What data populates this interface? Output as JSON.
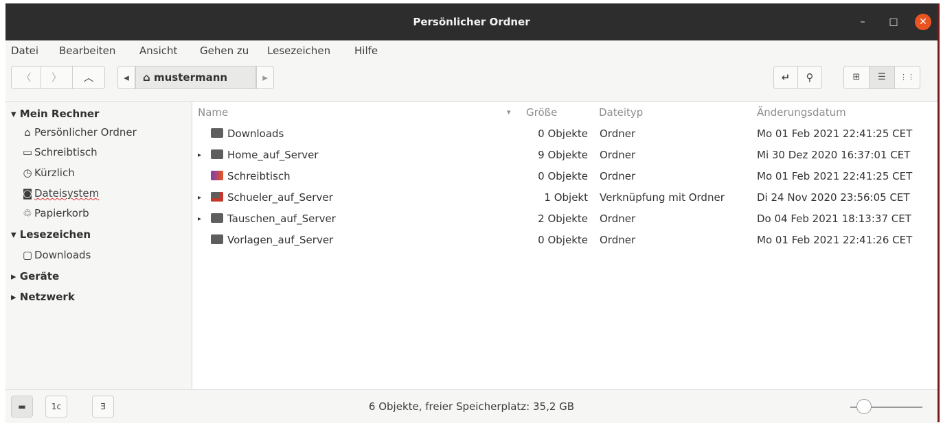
{
  "window": {
    "title": "Persönlicher Ordner",
    "minimize": "–",
    "maximize": "□",
    "close": "✕"
  },
  "menu": [
    "Datei",
    "Bearbeiten",
    "Ansicht",
    "Gehen zu",
    "Lesezeichen",
    "Hilfe"
  ],
  "toolbar": {
    "back": "〈",
    "forward": "〉",
    "up": "︿",
    "path_left": "◂",
    "path_home_icon": "⌂",
    "path_current": "mustermann",
    "path_right": "▸",
    "terminal": "↵",
    "search": "⚲",
    "grid_view": "⊞",
    "list_view": "☰",
    "options": "⋮⋮"
  },
  "sidebar": {
    "sections": [
      {
        "label": "Mein Rechner",
        "expanded": "▾"
      },
      {
        "label": "Lesezeichen",
        "expanded": "▾"
      },
      {
        "label": "Geräte",
        "expanded": "▸"
      },
      {
        "label": "Netzwerk",
        "expanded": "▸"
      }
    ],
    "computer_items": [
      {
        "icon": "⌂",
        "label": "Persönlicher Ordner"
      },
      {
        "icon": "▭",
        "label": "Schreibtisch"
      },
      {
        "icon": "◷",
        "label": "Kürzlich"
      },
      {
        "icon": "◙",
        "label": "Dateisystem"
      },
      {
        "icon": "♲",
        "label": "Papierkorb"
      }
    ],
    "bookmark_items": [
      {
        "icon": "▢",
        "label": "Downloads"
      }
    ]
  },
  "columns": {
    "name": "Name",
    "sort_indicator": "▾",
    "size": "Größe",
    "type": "Dateityp",
    "modified": "Änderungsdatum"
  },
  "files": [
    {
      "expander": "",
      "name": "Downloads",
      "size": "0 Objekte",
      "type": "Ordner",
      "modified": "Mo 01 Feb 2021 22:41:25 CET",
      "color": "#5e5e5e"
    },
    {
      "expander": "▸",
      "name": "Home_auf_Server",
      "size": "9 Objekte",
      "type": "Ordner",
      "modified": "Mi 30 Dez 2020 16:37:01 CET",
      "color": "#5e5e5e"
    },
    {
      "expander": "",
      "name": "Schreibtisch",
      "size": "0 Objekte",
      "type": "Ordner",
      "modified": "Mo 01 Feb 2021 22:41:25 CET",
      "color": "#a53fb5"
    },
    {
      "expander": "▸",
      "name": "Schueler_auf_Server",
      "size": "1 Objekt",
      "type": "Verknüpfung mit Ordner",
      "modified": "Di 24 Nov 2020 23:56:05 CET",
      "color": "#5e5e5e"
    },
    {
      "expander": "▸",
      "name": "Tauschen_auf_Server",
      "size": "2 Objekte",
      "type": "Ordner",
      "modified": "Do 04 Feb 2021 18:13:37 CET",
      "color": "#5e5e5e"
    },
    {
      "expander": "",
      "name": "Vorlagen_auf_Server",
      "size": "0 Objekte",
      "type": "Ordner",
      "modified": "Mo 01 Feb 2021 22:41:26 CET",
      "color": "#5e5e5e"
    }
  ],
  "statusbar": {
    "text": "6 Objekte, freier Speicherplatz: 35,2 GB",
    "btn_places": "▬",
    "btn_tree": "1c",
    "btn_terminal": "Ǝ"
  },
  "colors": {
    "accent": "#e95420",
    "titlebar": "#2d2d2d"
  }
}
